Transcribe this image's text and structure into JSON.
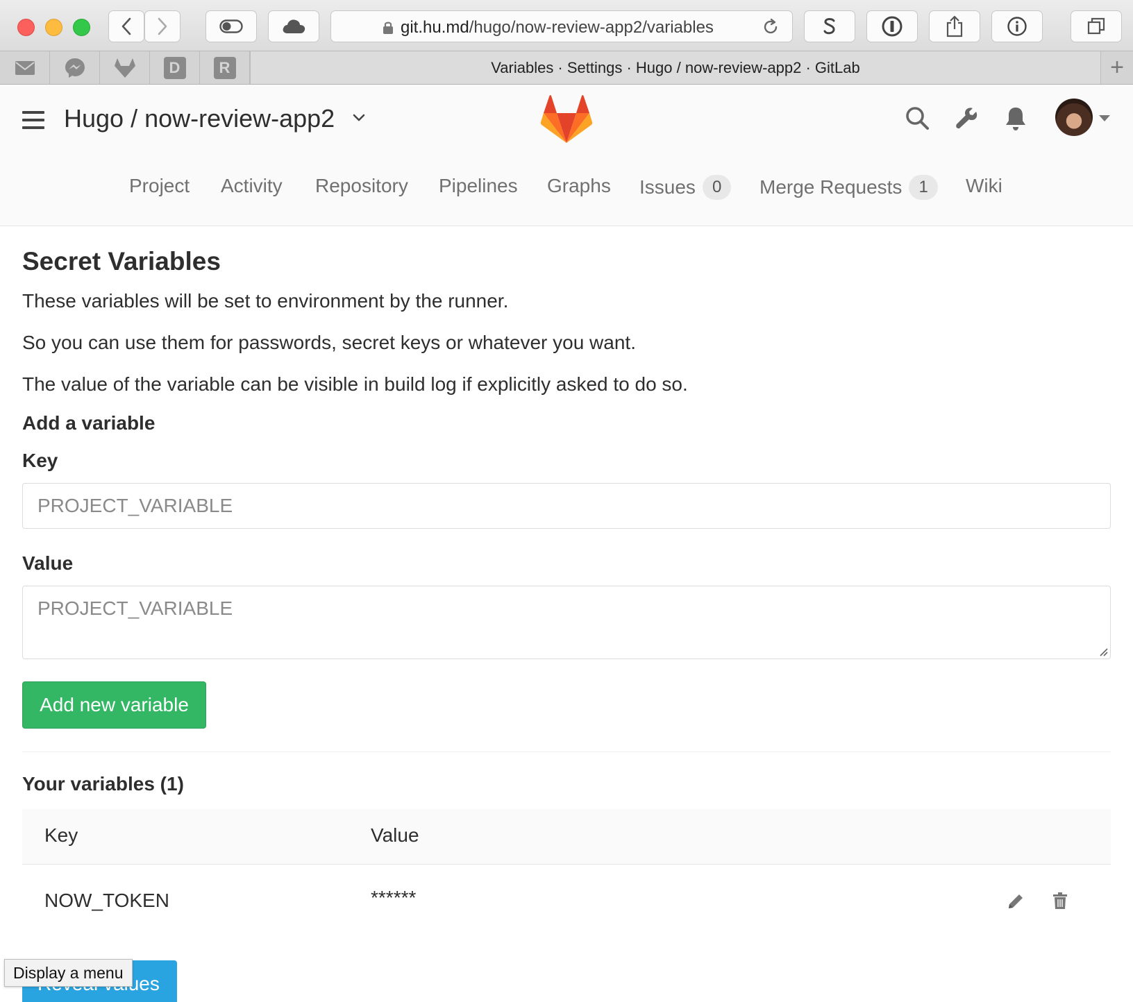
{
  "browser": {
    "url_host": "git.hu.md",
    "url_path": "/hugo/now-review-app2/variables",
    "tab_title": "Variables · Settings · Hugo / now-review-app2 · GitLab",
    "favorites": [
      {
        "name": "mail-icon"
      },
      {
        "name": "messenger-icon"
      },
      {
        "name": "gitlab-icon"
      },
      {
        "name": "d-bookmark-icon",
        "letter": "D"
      },
      {
        "name": "r-bookmark-icon",
        "letter": "R"
      }
    ],
    "new_tab_label": "+"
  },
  "header": {
    "project_title": "Hugo / now-review-app2"
  },
  "nav": {
    "items": [
      {
        "label": "Project"
      },
      {
        "label": "Activity"
      },
      {
        "label": "Repository"
      },
      {
        "label": "Pipelines"
      },
      {
        "label": "Graphs"
      },
      {
        "label": "Issues",
        "badge": "0"
      },
      {
        "label": "Merge Requests",
        "badge": "1"
      },
      {
        "label": "Wiki"
      }
    ]
  },
  "content": {
    "title": "Secret Variables",
    "paragraphs": [
      "These variables will be set to environment by the runner.",
      "So you can use them for passwords, secret keys or whatever you want.",
      "The value of the variable can be visible in build log if explicitly asked to do so."
    ],
    "add_heading": "Add a variable",
    "key_label": "Key",
    "key_placeholder": "PROJECT_VARIABLE",
    "value_label": "Value",
    "value_placeholder": "PROJECT_VARIABLE",
    "add_button": "Add new variable",
    "your_vars_heading": "Your variables (1)",
    "table": {
      "columns": [
        "Key",
        "Value"
      ],
      "rows": [
        {
          "key": "NOW_TOKEN",
          "value": "******"
        }
      ]
    },
    "reveal_button": "Reveal values"
  },
  "tooltip": "Display a menu",
  "colors": {
    "accent_green": "#33b764",
    "reveal_blue": "#2aa4e0"
  }
}
